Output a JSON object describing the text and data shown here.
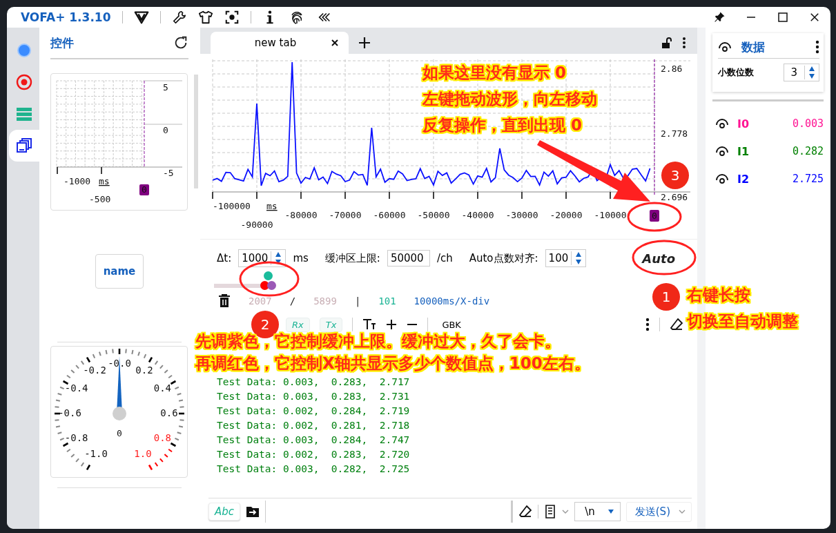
{
  "window": {
    "title": "VOFA+ 1.3.10"
  },
  "rail": [
    {
      "kind": "connect",
      "selected": false
    },
    {
      "kind": "record",
      "selected": false
    },
    {
      "kind": "list",
      "selected": false
    },
    {
      "kind": "widgets",
      "selected": true
    }
  ],
  "controls_panel": {
    "title": "控件",
    "mini_chart": {
      "y_labels": [
        "5",
        "0",
        "-5"
      ],
      "x_labels": [
        "-1000",
        "-500"
      ],
      "unit": "ms",
      "cursor": "0"
    },
    "button": {
      "label": "name"
    },
    "gauge": {
      "value": "0",
      "level": 0.5,
      "labels": [
        {
          "text": "-1.0",
          "danger": false
        },
        {
          "text": "-0.8",
          "danger": false
        },
        {
          "text": "-0.6",
          "danger": false
        },
        {
          "text": "-0.4",
          "danger": false
        },
        {
          "text": "-0.2",
          "danger": false
        },
        {
          "text": "-0.0",
          "danger": false
        },
        {
          "text": "0.2",
          "danger": false
        },
        {
          "text": "0.4",
          "danger": false
        },
        {
          "text": "0.6",
          "danger": false
        },
        {
          "text": "0.8",
          "danger": true
        },
        {
          "text": "1.0",
          "danger": true
        }
      ]
    }
  },
  "tabs": [
    {
      "label": "new tab",
      "selected": true
    }
  ],
  "chart": {
    "y_labels": [
      "2.86",
      "2.778",
      "2.696"
    ],
    "x_labels": [
      "-100000",
      "-90000",
      "-80000",
      "-70000",
      "-60000",
      "-50000",
      "-40000",
      "-30000",
      "-20000",
      "-10000"
    ],
    "unit": "ms",
    "cursor": "0"
  },
  "settings": {
    "dt_label": "Δt:",
    "dt_value": "1000",
    "dt_unit": "ms",
    "buffer_label": "缓冲区上限:",
    "buffer_value": "50000",
    "buffer_unit": "/ch",
    "align_label": "Auto点数对齐:",
    "align_value": "100",
    "auto_button": "Auto"
  },
  "slider": {
    "thumbs": [
      {
        "kind": "upper",
        "color": "#1abc9c",
        "level": 0.92
      },
      {
        "kind": "lower",
        "color": "#ff0000",
        "level": 0.86
      },
      {
        "kind": "lower",
        "color": "#9b59b6",
        "level": 0.98
      }
    ]
  },
  "stats": {
    "received": "2007",
    "sep1": "/",
    "total": "5899",
    "sep2": "|",
    "points": "101",
    "scale": "10000ms/X-div"
  },
  "toolbar": {
    "rx": "Rx",
    "tx": "Tx",
    "encoding": "GBK"
  },
  "log": {
    "lines": [
      "Test Data: 0.003,  0.283,  2.717",
      "Test Data: 0.003,  0.283,  2.731",
      "Test Data: 0.002,  0.284,  2.719",
      "Test Data: 0.002,  0.281,  2.718",
      "Test Data: 0.003,  0.284,  2.747",
      "Test Data: 0.002,  0.283,  2.720",
      "Test Data: 0.003,  0.282,  2.725"
    ]
  },
  "input_bar": {
    "mode_button": "Abc",
    "line_ending": "\\n",
    "send_button": "发送(S)"
  },
  "data_panel": {
    "title": "数据",
    "decimals_label": "小数位数",
    "decimals_value": "3",
    "channels": [
      {
        "name": "I0",
        "value": "0.003",
        "color": "#ff1493"
      },
      {
        "name": "I1",
        "value": "0.282",
        "color": "#008000"
      },
      {
        "name": "I2",
        "value": "2.725",
        "color": "#0000ff"
      }
    ]
  },
  "annotations": {
    "badges": [
      "1",
      "2",
      "3"
    ],
    "callouts": [
      {
        "lines": [
          "如果这里没有显示 0",
          "左键拖动波形，向左移动",
          "反复操作，直到出现 0"
        ]
      },
      {
        "lines": [
          "右键长按",
          "切换至自动调整"
        ]
      },
      {
        "lines": [
          "先调紫色，它控制缓冲上限。缓冲过大，久了会卡。",
          "再调红色，它控制X轴共显示多少个数值点，100左右。"
        ]
      }
    ]
  }
}
